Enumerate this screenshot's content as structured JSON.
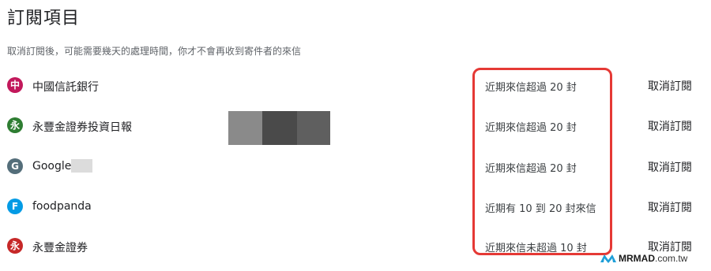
{
  "header": {
    "title": "訂閱項目",
    "subtitle": "取消訂閱後，可能需要幾天的處理時間，你才不會再收到寄件者的來信"
  },
  "subscriptions": [
    {
      "avatar_letter": "中",
      "avatar_color": "#c2185b",
      "sender": "中國信託銀行",
      "frequency": "近期來信超過 20 封",
      "action": "取消訂閱"
    },
    {
      "avatar_letter": "永",
      "avatar_color": "#2e7d32",
      "sender": "永豐金證券投資日報",
      "frequency": "近期來信超過 20 封",
      "action": "取消訂閱"
    },
    {
      "avatar_letter": "G",
      "avatar_color": "#546e7a",
      "sender": "Google",
      "frequency": "近期來信超過 20 封",
      "action": "取消訂閱"
    },
    {
      "avatar_letter": "F",
      "avatar_color": "#039be5",
      "sender": "foodpanda",
      "frequency": "近期有 10 到 20 封來信",
      "action": "取消訂閱"
    },
    {
      "avatar_letter": "永",
      "avatar_color": "#c62828",
      "sender": "永豐金證券",
      "frequency": "近期來信未超過 10 封",
      "action": "取消訂閱"
    }
  ],
  "watermark": {
    "brand": "MRMAD",
    "domain": ".com.tw"
  },
  "colors": {
    "highlight_box": "#e53935",
    "text_primary": "#202124",
    "text_secondary": "#5f6368"
  }
}
